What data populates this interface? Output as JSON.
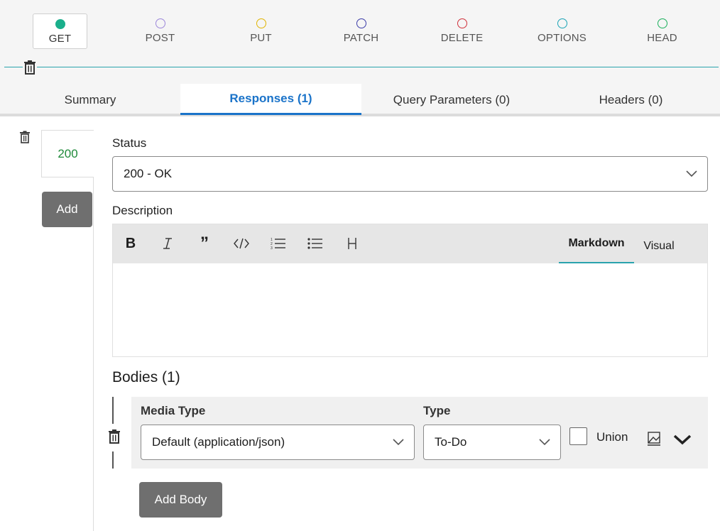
{
  "methods": [
    {
      "label": "GET",
      "color": "#1aaf8b",
      "active": true
    },
    {
      "label": "POST",
      "color": "#9b86d9",
      "active": false
    },
    {
      "label": "PUT",
      "color": "#e0b400",
      "active": false
    },
    {
      "label": "PATCH",
      "color": "#3b3ba8",
      "active": false
    },
    {
      "label": "DELETE",
      "color": "#d0303a",
      "active": false
    },
    {
      "label": "OPTIONS",
      "color": "#1aa3b5",
      "active": false
    },
    {
      "label": "HEAD",
      "color": "#1aaf5b",
      "active": false
    }
  ],
  "tabs": [
    {
      "label": "Summary",
      "active": false
    },
    {
      "label": "Responses (1)",
      "active": true
    },
    {
      "label": "Query Parameters (0)",
      "active": false
    },
    {
      "label": "Headers (0)",
      "active": false
    }
  ],
  "responses": {
    "items": [
      {
        "code": "200"
      }
    ],
    "add_label": "Add"
  },
  "status": {
    "label": "Status",
    "value": "200 - OK"
  },
  "description": {
    "label": "Description",
    "toolbar": [
      "bold-icon",
      "italic-icon",
      "quote-icon",
      "code-icon",
      "ordered-list-icon",
      "bullet-list-icon",
      "heading-icon"
    ],
    "modes": [
      {
        "label": "Markdown",
        "active": true
      },
      {
        "label": "Visual",
        "active": false
      }
    ],
    "content": ""
  },
  "bodies": {
    "title": "Bodies (1)",
    "items": [
      {
        "media_type_label": "Media Type",
        "media_type_value": "Default (application/json)",
        "type_label": "Type",
        "type_value": "To-Do",
        "union_label": "Union",
        "union_checked": false
      }
    ],
    "add_label": "Add Body"
  },
  "colors": {
    "accent_blue": "#1a73c9",
    "accent_teal": "#2aa3ad",
    "status_green": "#1f8a3a",
    "button_gray": "#6f6f6f"
  }
}
